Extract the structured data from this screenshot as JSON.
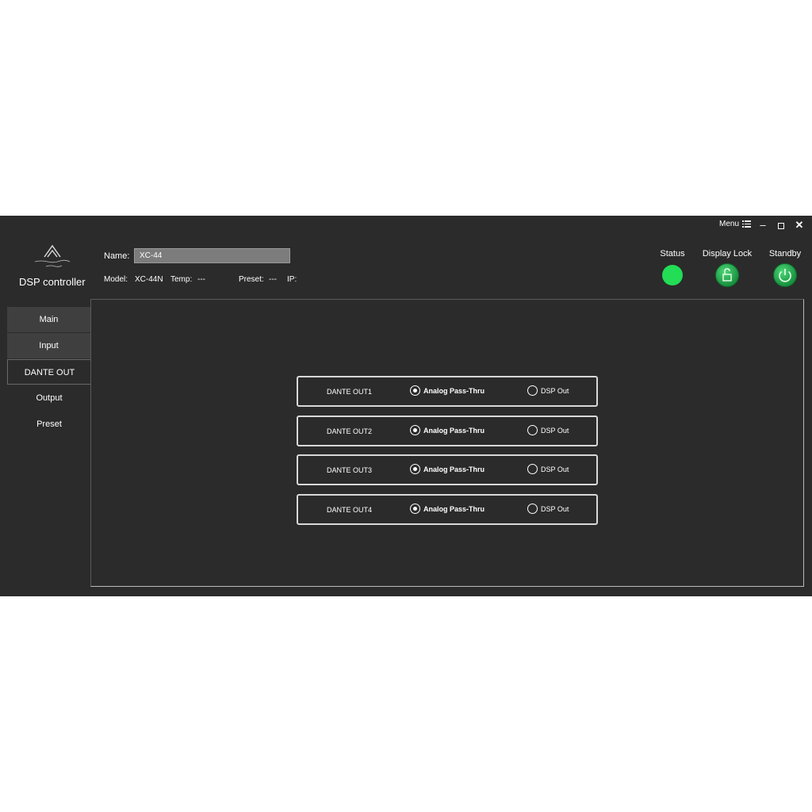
{
  "window": {
    "menu_label": "Menu"
  },
  "app": {
    "title": "DSP controller"
  },
  "device": {
    "name_label": "Name:",
    "name_value": "XC-44",
    "model_label": "Model:",
    "model_value": "XC-44N",
    "temp_label": "Temp:",
    "temp_value": "---",
    "preset_label": "Preset:",
    "preset_value": "---",
    "ip_label": "IP:"
  },
  "indicators": {
    "status_label": "Status",
    "display_lock_label": "Display Lock",
    "standby_label": "Standby",
    "status_color": "#22dd55"
  },
  "sidebar": {
    "items": [
      {
        "label": "Main"
      },
      {
        "label": "Input"
      },
      {
        "label": "DANTE OUT"
      },
      {
        "label": "Output"
      },
      {
        "label": "Preset"
      }
    ],
    "active": "DANTE OUT"
  },
  "dante_outputs": [
    {
      "label": "DANTE OUT1",
      "option_a": "Analog Pass-Thru",
      "option_b": "DSP Out",
      "selected": "Analog Pass-Thru"
    },
    {
      "label": "DANTE OUT2",
      "option_a": "Analog Pass-Thru",
      "option_b": "DSP Out",
      "selected": "Analog Pass-Thru"
    },
    {
      "label": "DANTE OUT3",
      "option_a": "Analog Pass-Thru",
      "option_b": "DSP Out",
      "selected": "Analog Pass-Thru"
    },
    {
      "label": "DANTE OUT4",
      "option_a": "Analog Pass-Thru",
      "option_b": "DSP Out",
      "selected": "Analog Pass-Thru"
    }
  ]
}
